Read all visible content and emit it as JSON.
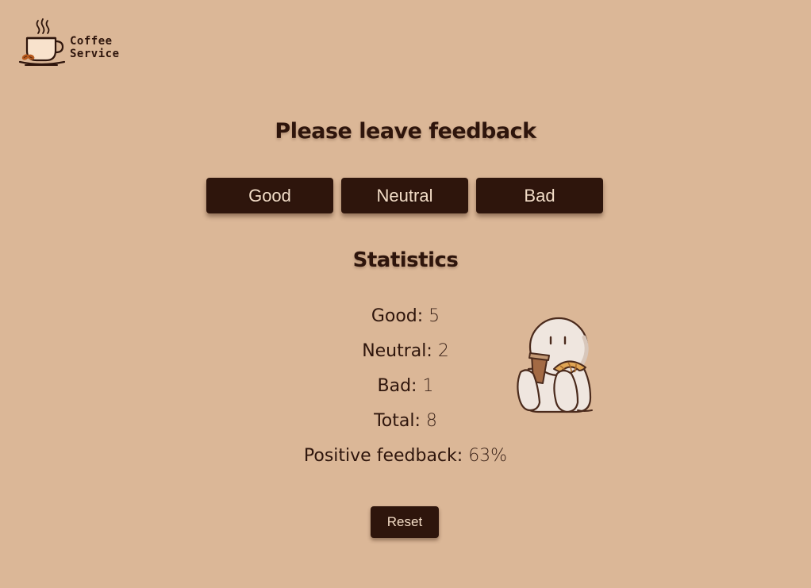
{
  "logo": {
    "line1": "Coffee",
    "line2": "Service",
    "icon": "coffee-cup-icon"
  },
  "title": "Please leave feedback",
  "buttons": {
    "good": "Good",
    "neutral": "Neutral",
    "bad": "Bad"
  },
  "statistics": {
    "title": "Statistics",
    "good_label": "Good:",
    "good_value": "5",
    "neutral_label": "Neutral:",
    "neutral_value": "2",
    "bad_label": "Bad:",
    "bad_value": "1",
    "total_label": "Total:",
    "total_value": "8",
    "positive_label": "Positive feedback:",
    "positive_value": "63%"
  },
  "reset_label": "Reset",
  "mascot": "mascot-with-coffee-and-croissant",
  "colors": {
    "background": "#dbb797",
    "primary": "#2e150c",
    "button_text": "#f3dcc6"
  }
}
